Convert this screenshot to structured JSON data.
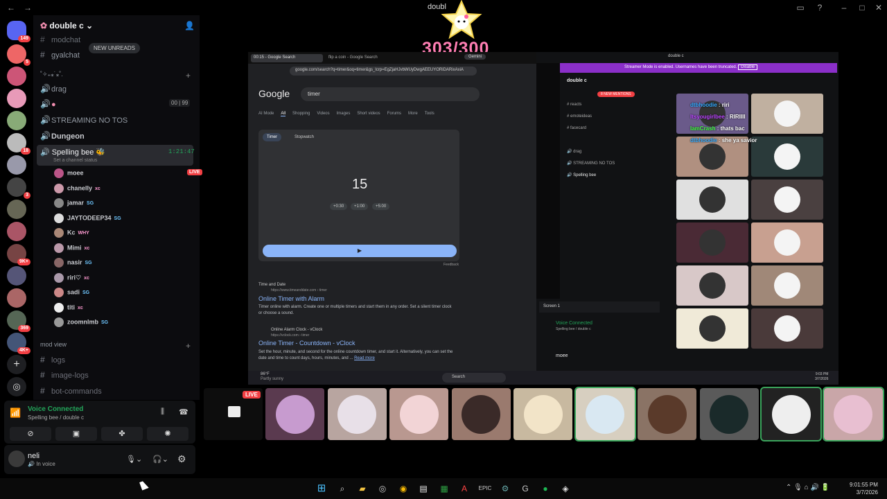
{
  "window": {
    "title": "doubl",
    "counter": "303/300"
  },
  "server": {
    "name": "double c",
    "new_unreads": "NEW UNREADS"
  },
  "channels": [
    {
      "icon": "#",
      "name": "modchat",
      "muted": true
    },
    {
      "icon": "#",
      "name": "gyalchat",
      "muted": true
    },
    {
      "icon": "vc",
      "name": "drag"
    },
    {
      "icon": "vc",
      "name": "",
      "counter_a": "00",
      "counter_b": "99"
    },
    {
      "icon": "vc",
      "name": "STREAMING NO TOS"
    },
    {
      "icon": "vc",
      "name": "Dungeon"
    }
  ],
  "category1": "˚✧₊⁎˙⁎˚.",
  "active_voice": {
    "name": "Spelling bee",
    "timer": "1:21:47",
    "status": "Set a channel status"
  },
  "members": [
    {
      "name": "moee",
      "tag": "",
      "live": "LIVE"
    },
    {
      "name": "chanelly",
      "tag": "xc"
    },
    {
      "name": "jamar",
      "tag": "SG"
    },
    {
      "name": "JAYTODEEP34",
      "tag": "SG"
    },
    {
      "name": "Kc",
      "tag": "WHY"
    },
    {
      "name": "Mimi",
      "tag": "xc"
    },
    {
      "name": "nasir",
      "tag": "SG"
    },
    {
      "name": "riri♡",
      "tag": "xc"
    },
    {
      "name": "sadi",
      "tag": "SG"
    },
    {
      "name": "titi",
      "tag": "xc"
    },
    {
      "name": "zoomnlmb",
      "tag": "SG"
    }
  ],
  "category2": "mod view",
  "channels2": [
    "logs",
    "image-logs",
    "bot-commands"
  ],
  "server_badges": [
    "149",
    "5",
    "18",
    "3",
    "9K+",
    "369",
    "4K+"
  ],
  "voice_panel": {
    "status": "Voice Connected",
    "location": "Spelling bee / double c"
  },
  "user": {
    "name": "neli",
    "status": "In voice"
  },
  "chrome": {
    "tabs": [
      "00:15 - Google Search",
      "flip a coin - Google Search"
    ],
    "url": "google.com/search?q=timer&oq=timer&gs_lcrp=EgZjaHJvbWUyDwgAEEUYORiDARixAxiA",
    "gemini": "Gemini",
    "logo": "Google",
    "query": "timer",
    "filters": [
      "AI Mode",
      "All",
      "Shopping",
      "Videos",
      "Images",
      "Short videos",
      "Forums",
      "More",
      "Tools"
    ],
    "timer_tab": "Timer",
    "stopwatch_tab": "Stopwatch",
    "timer_value": "15",
    "buttons": [
      "+0:30",
      "+1:00",
      "+5:00"
    ],
    "feedback": "Feedback",
    "results": [
      {
        "site": "Time and Date",
        "url": "https://www.timeanddate.com › timer",
        "title": "Online Timer with Alarm",
        "snippet": "Timer online with alarm. Create one or multiple timers and start them in any order. Set a silent timer clock or choose a sound."
      },
      {
        "site": "Online Alarm Clock - vClock",
        "url": "https://vclock.com › timer",
        "title": "Online Timer - Countdown - vClock",
        "snippet": "Set the hour, minute, and second for the online countdown timer, and start it. Alternatively, you can set the date and time to count days, hours, minutes, and ...",
        "more": "Read more"
      }
    ]
  },
  "inner_discord": {
    "title": "double c",
    "banner": "Streamer Mode is enabled. Usernames have been truncated.",
    "disable": "Disable",
    "new_mentions": "8 NEW MENTIONS",
    "channels": [
      "reacts",
      "emoteideas",
      "facecard",
      "drag",
      "STREAMING NO TOS",
      "Spelling bee"
    ],
    "screen": "Screen 1",
    "voice": "Voice Connected",
    "voice_loc": "Spelling bee / double c",
    "user": "moee",
    "chat": [
      {
        "name": "dtbhoodie",
        "text": "riri"
      },
      {
        "name": "Itsyougirlbee",
        "text": "RIRIIII"
      },
      {
        "name": "IamCrash",
        "text": "thats bac"
      },
      {
        "name": "dtbhoodie",
        "text": "she ya savior"
      }
    ]
  },
  "inner_taskbar": {
    "weather": "86°F",
    "weather_desc": "Partly sunny",
    "search": "Search",
    "time": "9:03 PM",
    "date": "3/7/2026"
  },
  "strip": {
    "live": "LIVE"
  },
  "taskbar": {
    "time": "9:01:55 PM",
    "date": "3/7/2026"
  },
  "colors": {
    "accent": "#5865f2",
    "live": "#f23f43",
    "connected": "#23a55a",
    "banner": "#8b2fc9"
  }
}
